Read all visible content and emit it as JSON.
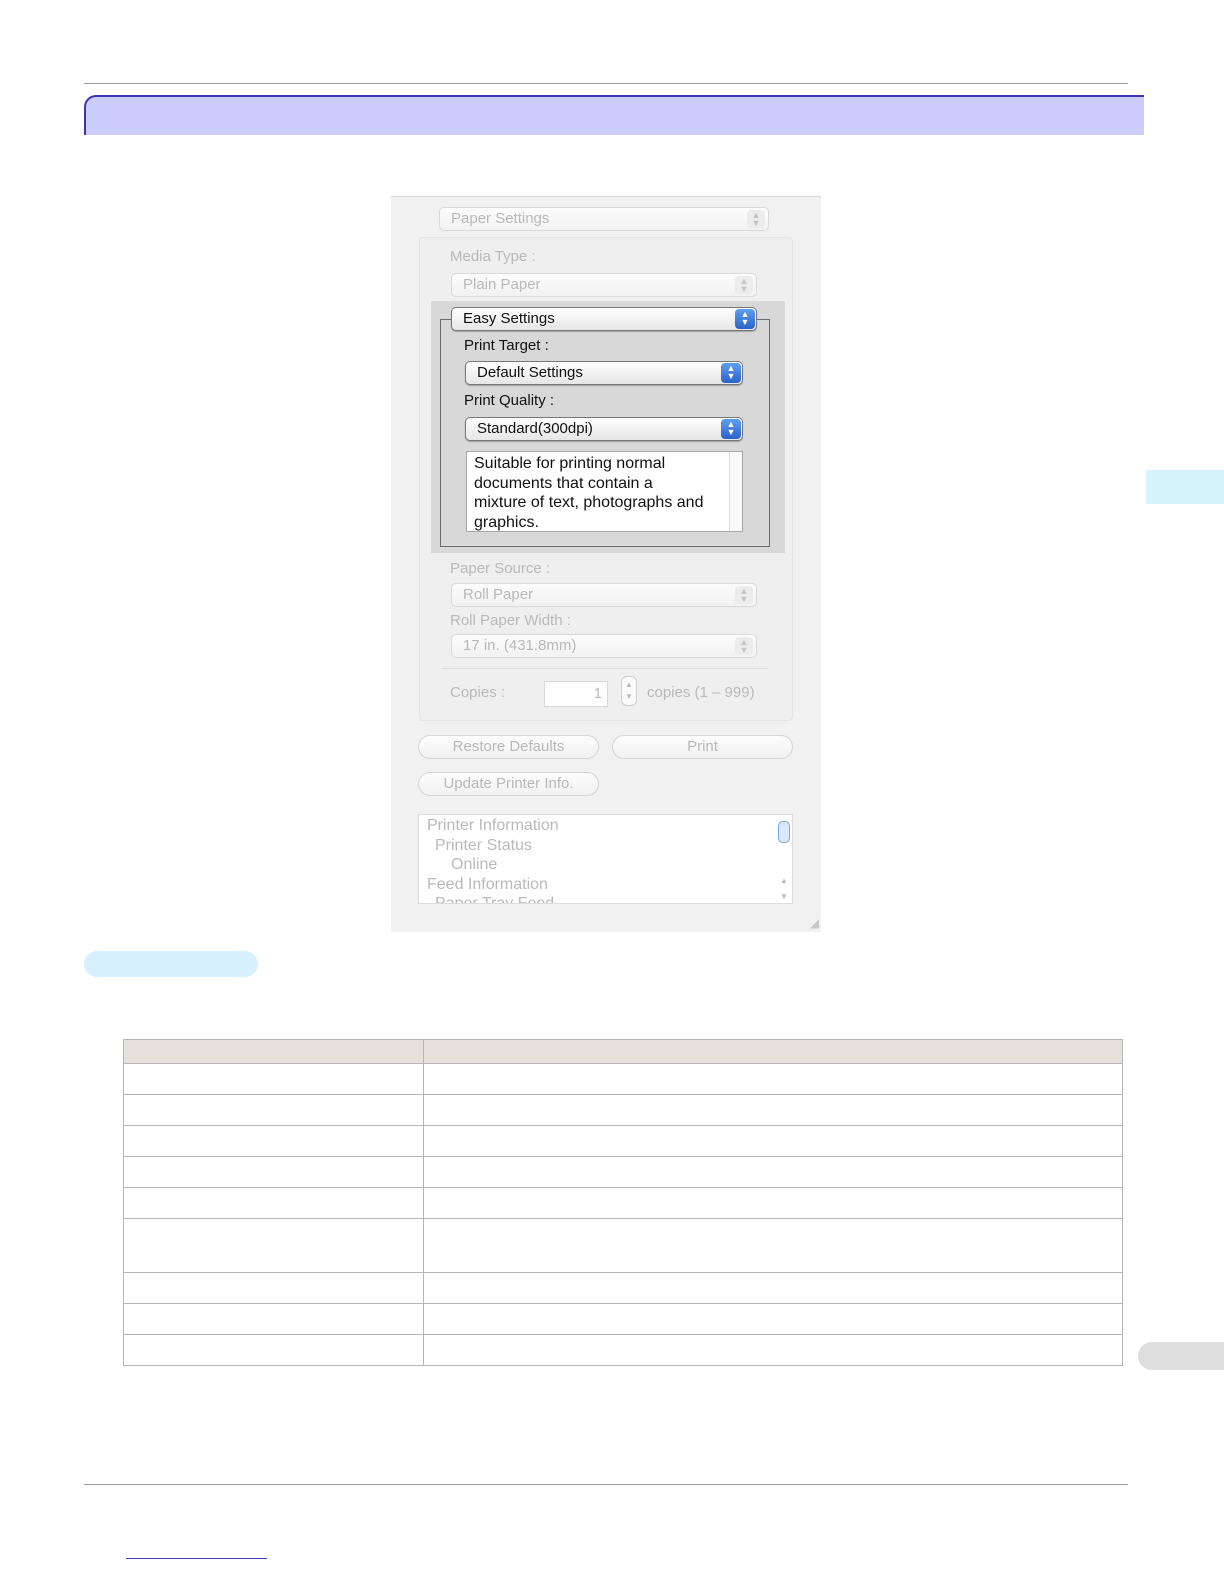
{
  "dialog": {
    "header_popup": "Paper Settings",
    "media_type": {
      "label": "Media Type :",
      "value": "Plain Paper"
    },
    "easy_settings": {
      "value": "Easy Settings"
    },
    "print_target": {
      "label": "Print Target :",
      "value": "Default Settings"
    },
    "print_quality": {
      "label": "Print Quality :",
      "value": "Standard(300dpi)"
    },
    "description": {
      "lines": [
        "Suitable for printing normal",
        "documents that contain a",
        "mixture of text, photographs and",
        "graphics."
      ]
    },
    "paper_source": {
      "label": "Paper Source :",
      "value": "Roll Paper"
    },
    "roll_paper_width": {
      "label": "Roll Paper Width :",
      "value": "17 in. (431.8mm)"
    },
    "copies": {
      "label": "Copies :",
      "value": "1",
      "range_text": "copies (1 – 999)"
    },
    "buttons": {
      "restore_defaults": "Restore Defaults",
      "print": "Print",
      "update_printer_info": "Update Printer Info."
    },
    "info_list": [
      "Printer Information",
      "Printer Status",
      "Online",
      "Feed Information",
      "Paper Tray Feed"
    ]
  },
  "icons": {
    "popup_arrows": "updown-arrows-icon",
    "stepper": "stepper-icon",
    "resize_grip": "resize-grip-icon"
  },
  "colors": {
    "title_bar_fill": "#cccdfc",
    "title_bar_border": "#3a35b6",
    "side_tab": "#d6f3fb",
    "section_pill": "#d6f1fd",
    "table_header": "#e6e0db"
  }
}
